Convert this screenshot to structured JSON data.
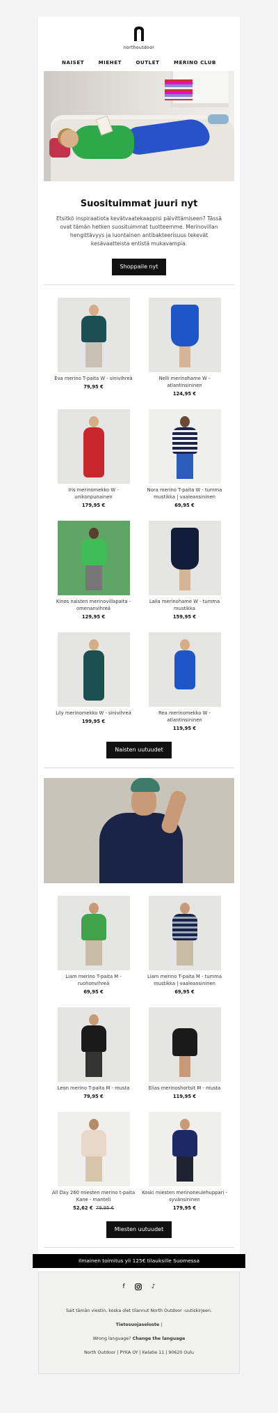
{
  "brand": {
    "name": "northoutdoor",
    "icon": "north-outdoor-logo"
  },
  "nav": [
    "NAISET",
    "MIEHET",
    "OUTLET",
    "MERINO CLUB"
  ],
  "section1": {
    "title": "Suosituimmat juuri nyt",
    "text": "Etsitkö inspiraatiota kevätvaatekaappisi päivittämiseen? Tässä ovat tämän hetken suosituimmat tuotteemme. Merinovillan hengittävyys ja luontainen antibakteerisuus tekevät kesävaatteista entistä mukavampia.",
    "button": "Shoppaile nyt"
  },
  "women_products": [
    {
      "name": "Eva merino T-paita W - sinivihreä",
      "price": "79,95 €"
    },
    {
      "name": "Nelli merinohame W - atlantinsininen",
      "price": "124,95 €"
    },
    {
      "name": "Iris merinomekko W - unikonpunainen",
      "price": "179,95 €"
    },
    {
      "name": "Nora merino T-paita W - tumma mustikka | vaaleansininen",
      "price": "69,95 €"
    },
    {
      "name": "Kinos naisten merinovillapaita - omenanvihreä",
      "price": "129,95 €"
    },
    {
      "name": "Laila merinohame W - tumma mustikka",
      "price": "159,95 €"
    },
    {
      "name": "Lily merinomekko W - sinivihreä",
      "price": "199,95 €"
    },
    {
      "name": "Rea merinomekko W - atlantinsininen",
      "price": "119,95 €"
    }
  ],
  "women_button": "Naisten uutuudet",
  "men_products": [
    {
      "name": "Liam merino T-paita M - ruohonvihreä",
      "price": "69,95 €"
    },
    {
      "name": "Liam merino T-paita M - tumma mustikka | vaaleansininen",
      "price": "69,95 €"
    },
    {
      "name": "Leon merino T-paita M - musta",
      "price": "79,95 €"
    },
    {
      "name": "Elias merinoshortsit M - musta",
      "price": "119,95 €"
    },
    {
      "name": "All Day 260 miesten merino t-paita Kane - manteli",
      "price": "52,62 €",
      "old_price": "79,95 €"
    },
    {
      "name": "Koski miesten merinoneulehuppari - syvänsininen",
      "price": "179,95 €"
    }
  ],
  "men_button": "Miesten uutuudet",
  "shipping": "Ilmainen toimitus yli 125€ tilauksille Suomessa",
  "footer": {
    "socials": [
      "facebook-icon",
      "instagram-icon",
      "tiktok-icon"
    ],
    "subscribed": "Sait tämän viestin, koska olet tilannut North Outdoor -uutiskirjeen.",
    "privacy": "Tietosuojaseloste",
    "separator": "|",
    "wrong_lang": "Wrong language?",
    "change_lang": "Change the language",
    "address": "North Outdoor | PYKA OY | Kelatie 11 | 90620 Oulu"
  }
}
